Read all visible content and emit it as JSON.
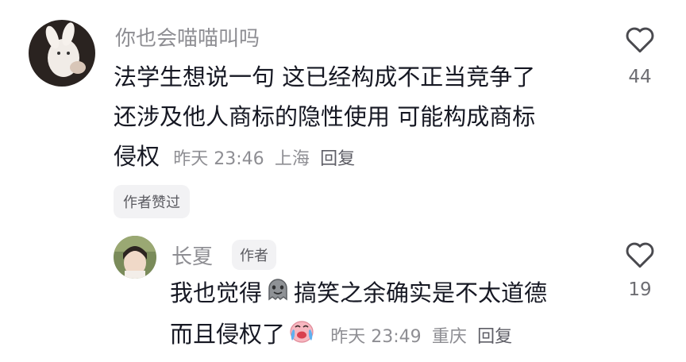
{
  "comments": [
    {
      "username": "你也会喵喵叫吗",
      "text_line1": "法学生想说一句 这已经构成不正当竞争了",
      "text_line2": "还涉及他人商标的隐性使用 可能构成商标",
      "text_line3": "侵权",
      "time": "昨天 23:46",
      "location": "上海",
      "reply_label": "回复",
      "likes": "44",
      "liked_badge": "作者赞过"
    }
  ],
  "reply": {
    "username": "长夏",
    "author_badge": "作者",
    "text_part1": "我也觉得",
    "text_part2": "搞笑之余确实是不太道德",
    "text_part3": "而且侵权了",
    "time": "昨天 23:49",
    "location": "重庆",
    "reply_label": "回复",
    "likes": "19",
    "emoji1": "ghost-smile-emoji",
    "emoji2": "crying-emoji"
  },
  "colors": {
    "text": "#161823",
    "muted": "#8e8e93",
    "badge_bg": "#f2f2f4"
  }
}
